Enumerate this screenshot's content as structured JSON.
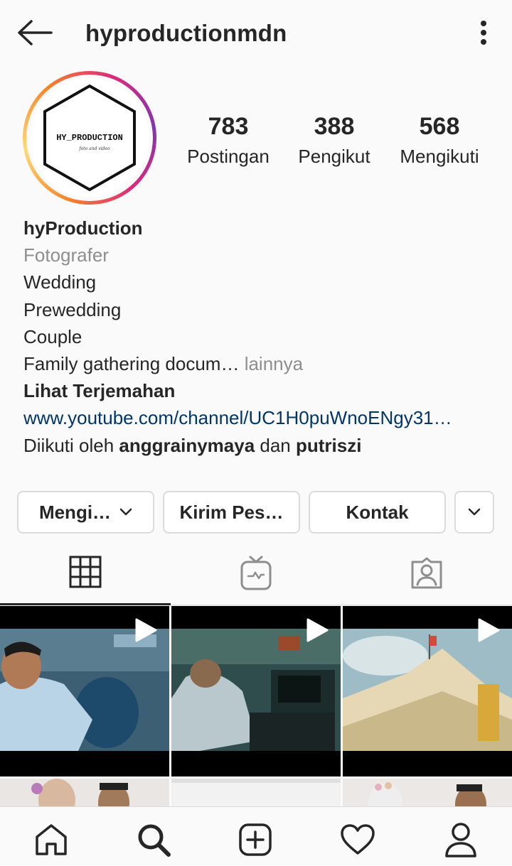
{
  "header": {
    "title": "hyproductionmdn"
  },
  "profile": {
    "avatar_text": "HY_PRODUCTION",
    "avatar_subtext": "foto and video",
    "stats": [
      {
        "value": "783",
        "label": "Postingan"
      },
      {
        "value": "388",
        "label": "Pengikut"
      },
      {
        "value": "568",
        "label": "Mengikuti"
      }
    ]
  },
  "bio": {
    "name": "hyProduction",
    "category": "Fotografer",
    "lines": [
      "Wedding",
      "Prewedding",
      "Couple"
    ],
    "last_line": "Family gathering docum…",
    "more": " lainnya",
    "translate": "Lihat Terjemahan",
    "link": "www.youtube.com/channel/UC1H0puWnoENgy31…",
    "followed_by_prefix": "Diikuti oleh ",
    "followed_by_user1": "anggrainymaya",
    "followed_by_and": " dan ",
    "followed_by_user2": "putriszi"
  },
  "actions": {
    "follow": "Mengi…",
    "message": "Kirim Pes…",
    "contact": "Kontak"
  },
  "tabs": [
    "grid",
    "igtv",
    "tagged"
  ],
  "active_tab": "grid",
  "colors": {
    "link": "#003569",
    "secondary_text": "#8e8e8e",
    "border": "#dbdbdb"
  }
}
